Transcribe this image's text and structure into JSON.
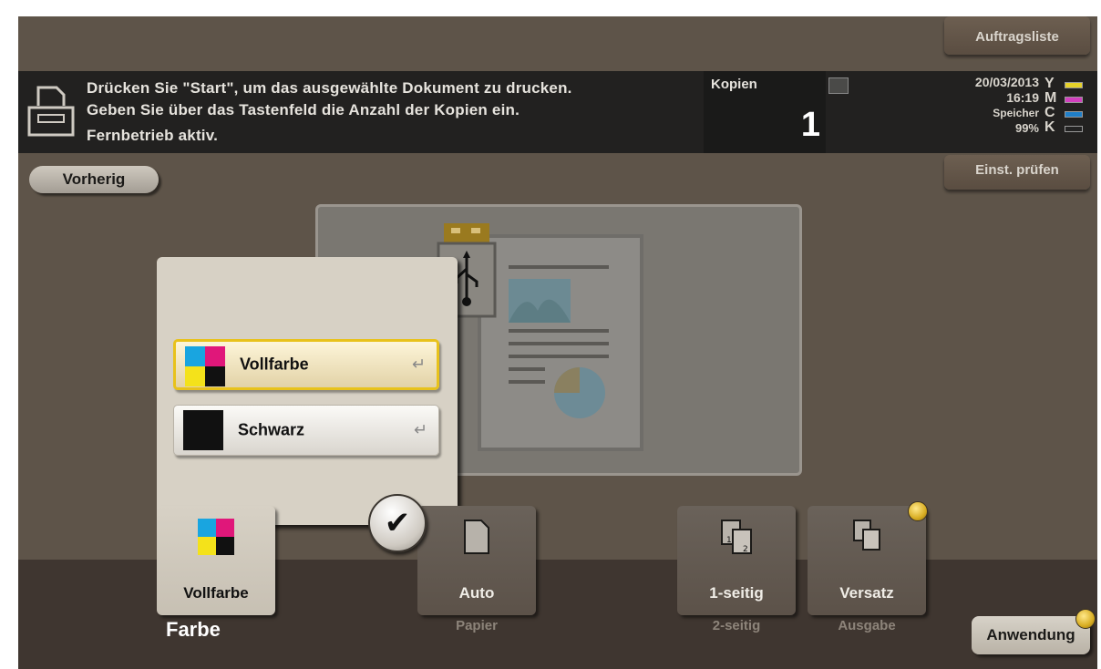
{
  "header": {
    "handle_label": "<< ◆ >>",
    "job_list_label": "Auftragsliste",
    "check_settings_label": "Einst. prüfen"
  },
  "message": {
    "line1": "Drücken Sie \"Start\", um das ausgewählte Dokument zu drucken.",
    "line2": "Geben Sie über das Tastenfeld die Anzahl der Kopien ein.",
    "line3": "Fernbetrieb aktiv."
  },
  "copies": {
    "label": "Kopien",
    "value": "1"
  },
  "status": {
    "date": "20/03/2013",
    "time": "16:19",
    "memory_label": "Speicher",
    "memory_percent": "99%",
    "toner": [
      {
        "letter": "Y",
        "color": "#e6d22a"
      },
      {
        "letter": "M",
        "color": "#d23fbf"
      },
      {
        "letter": "C",
        "color": "#1f7fc9"
      },
      {
        "letter": "K",
        "color": "#222222"
      }
    ]
  },
  "nav": {
    "back_label": "Vorherig"
  },
  "color_popup": {
    "options": [
      {
        "label": "Vollfarbe",
        "selected": true,
        "icon": "cmyk-icon"
      },
      {
        "label": "Schwarz",
        "selected": false,
        "icon": "black-square-icon"
      }
    ],
    "ok_icon": "checkmark-icon"
  },
  "functions": [
    {
      "id": "farbe",
      "value": "Vollfarbe",
      "category": "Farbe",
      "icon": "cmyk-icon"
    },
    {
      "id": "papier",
      "value": "Auto",
      "category": "Papier",
      "icon": "paper-icon"
    },
    {
      "id": "seitig",
      "value": "1-seitig",
      "category": "2-seitig",
      "icon": "duplex-icon"
    },
    {
      "id": "ausgabe",
      "value": "Versatz",
      "category": "Ausgabe",
      "icon": "offset-icon"
    }
  ],
  "application_label": "Anwendung",
  "colors": {
    "accent_yellow": "#e8c21b",
    "panel_bg": "#5e5449",
    "message_bg": "#222120",
    "bottom_bg": "#3f3630"
  }
}
